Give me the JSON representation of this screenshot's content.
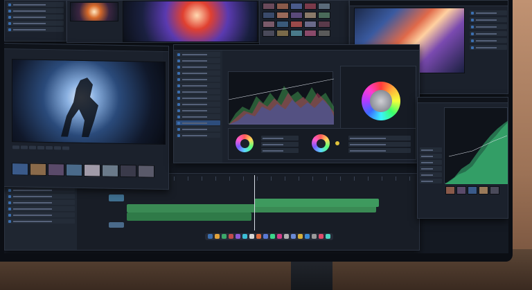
{
  "scene": {
    "colors": {
      "accent_blue": "#3b6fb0",
      "track_green": "#3aa35a",
      "track_teal": "#3f8fa0",
      "bg_panel": "#1b212c"
    }
  },
  "panels": {
    "top_left_browser": {
      "rows": 5
    },
    "viewer_main": {
      "rows": 0
    },
    "color_panel": {
      "rows": 14
    },
    "right_scope": {
      "rows": 6
    },
    "timeline": {
      "rows": 8
    }
  },
  "dock": {
    "icons": [
      "#3b6fb0",
      "#e0a23b",
      "#3ba86a",
      "#c24b4b",
      "#8a5ad6",
      "#3bbfd6",
      "#d6d6d6",
      "#e06a3b",
      "#5a7ad6",
      "#3bd68a",
      "#d63b8a",
      "#b0b0b0",
      "#6a8ad6",
      "#d6b03b",
      "#3b8ad6",
      "#9a9a9a",
      "#e04b6a",
      "#4bd6c2"
    ]
  }
}
